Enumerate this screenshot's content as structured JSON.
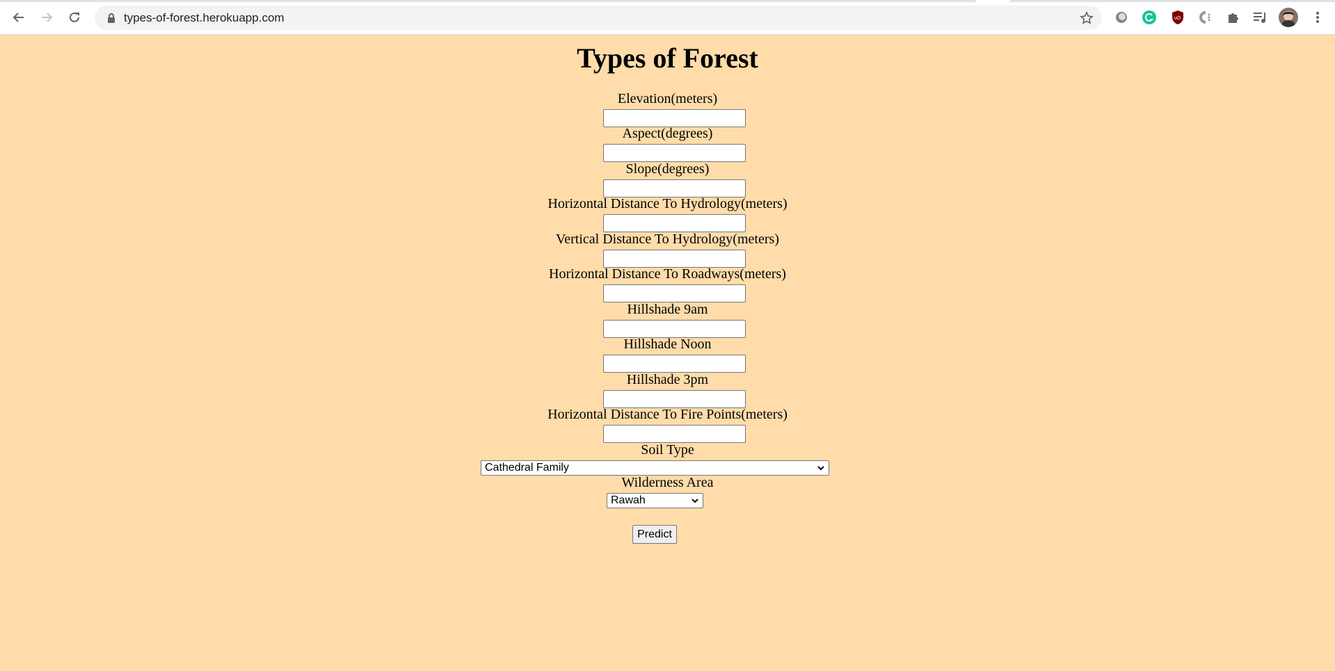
{
  "browser": {
    "url": "types-of-forest.herokuapp.com",
    "icons": [
      "back-icon",
      "forward-icon",
      "reload-icon",
      "lock-icon",
      "bookmark-star-icon",
      "extension-circle-icon",
      "grammarly-icon",
      "ublock-icon",
      "extension-c-icon",
      "extensions-puzzle-icon",
      "media-queue-icon",
      "profile-avatar",
      "menu-kebab-icon"
    ]
  },
  "page": {
    "title": "Types of Forest",
    "fields": [
      {
        "label": "Elevation(meters)",
        "value": ""
      },
      {
        "label": "Aspect(degrees)",
        "value": ""
      },
      {
        "label": "Slope(degrees)",
        "value": ""
      },
      {
        "label": "Horizontal Distance To Hydrology(meters)",
        "value": ""
      },
      {
        "label": "Vertical Distance To Hydrology(meters)",
        "value": ""
      },
      {
        "label": "Horizontal Distance To Roadways(meters)",
        "value": ""
      },
      {
        "label": "Hillshade 9am",
        "value": ""
      },
      {
        "label": "Hillshade Noon",
        "value": ""
      },
      {
        "label": "Hillshade 3pm",
        "value": ""
      },
      {
        "label": "Horizontal Distance To Fire Points(meters)",
        "value": ""
      }
    ],
    "soil_type": {
      "label": "Soil Type",
      "selected": "Cathedral Family"
    },
    "wilderness_area": {
      "label": "Wilderness Area",
      "selected": "Rawah"
    },
    "predict_label": "Predict"
  },
  "colors": {
    "page_background": "#ffdcaa"
  }
}
